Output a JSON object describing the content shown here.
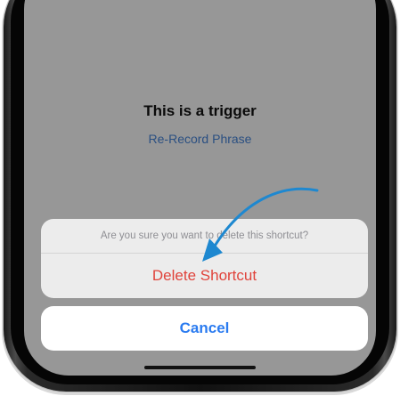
{
  "screen": {
    "title": "This is a trigger",
    "rerecord_link": "Re-Record Phrase"
  },
  "action_sheet": {
    "message": "Are you sure you want to delete this shortcut?",
    "delete_label": "Delete Shortcut",
    "cancel_label": "Cancel"
  },
  "colors": {
    "destructive": "#e0433b",
    "accent": "#2a7bf0",
    "annotation_arrow": "#1e88d0"
  },
  "annotation": {
    "icon": "curved-arrow-icon"
  }
}
